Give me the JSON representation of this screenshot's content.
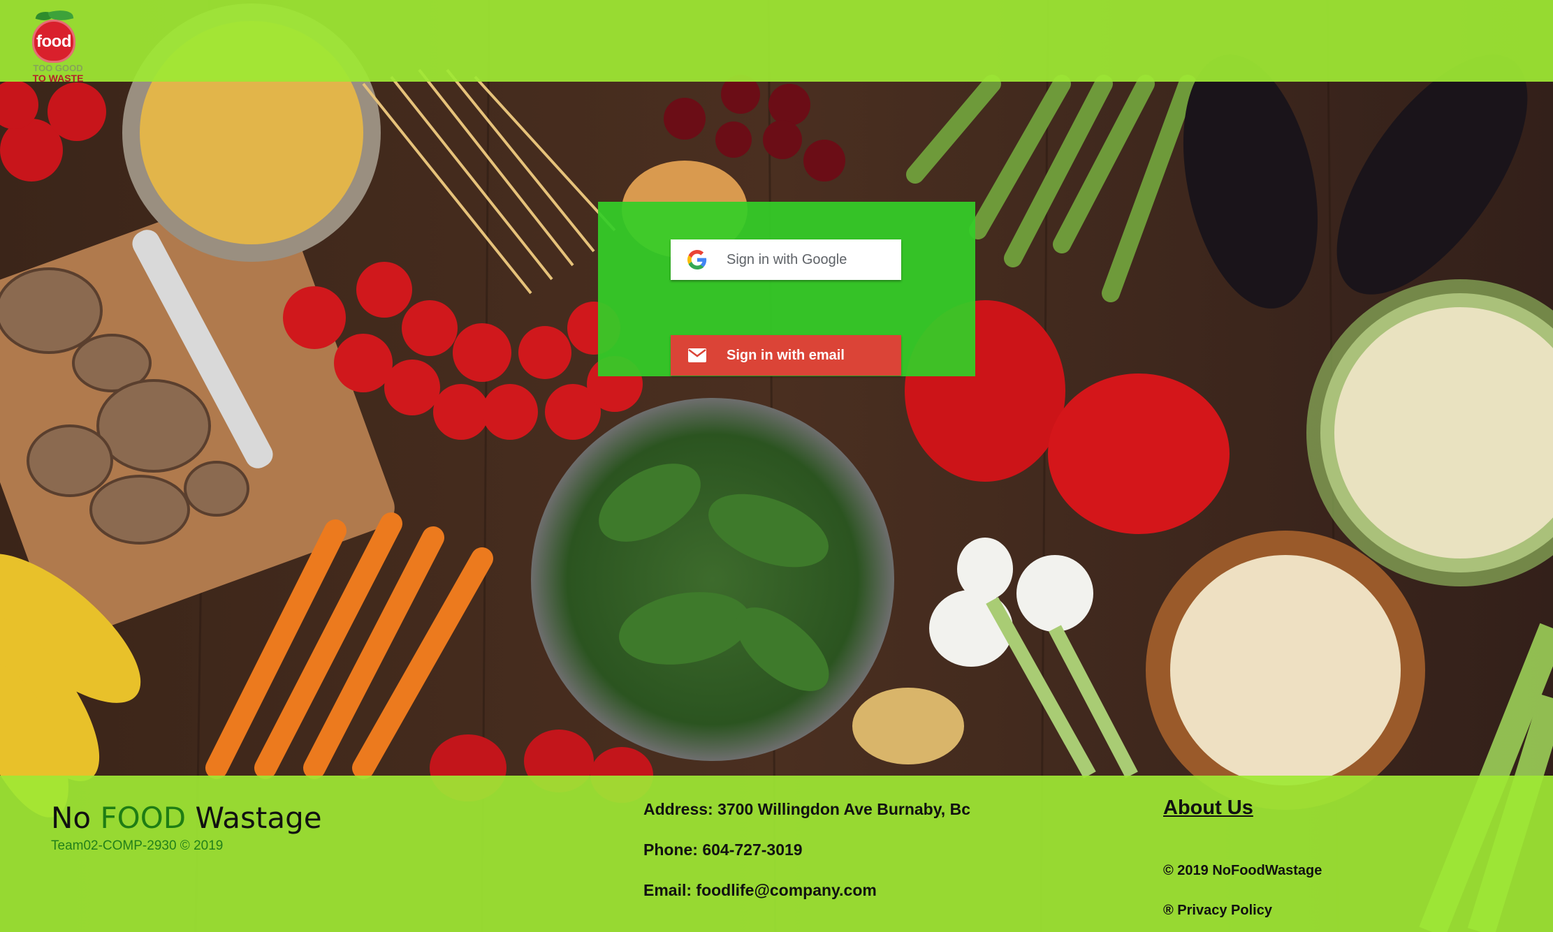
{
  "header": {
    "logo": {
      "word": "food",
      "tagline_top": "TOO GOOD",
      "tagline_bottom": "TO WASTE"
    }
  },
  "signin": {
    "google_label": "Sign in with Google",
    "email_label": "Sign in with email"
  },
  "footer": {
    "brand": {
      "part1": "No",
      "part2": "FOOD",
      "part3": "Wastage",
      "subtitle": "Team02-COMP-2930 © 2019"
    },
    "contact": {
      "address": "Address: 3700 Willingdon Ave Burnaby, Bc",
      "phone": "Phone: 604-727-3019",
      "email": "Email: foodlife@company.com"
    },
    "about_label": "About Us",
    "copyright": "© 2019 NoFoodWastage",
    "privacy": "® Privacy Policy"
  },
  "colors": {
    "header_green": "#9ee834",
    "panel_green": "#34ce28",
    "email_red": "#db4437",
    "brand_food_green": "#1e7d14"
  },
  "icons": {
    "google": "google-g-icon",
    "email": "envelope-icon"
  }
}
